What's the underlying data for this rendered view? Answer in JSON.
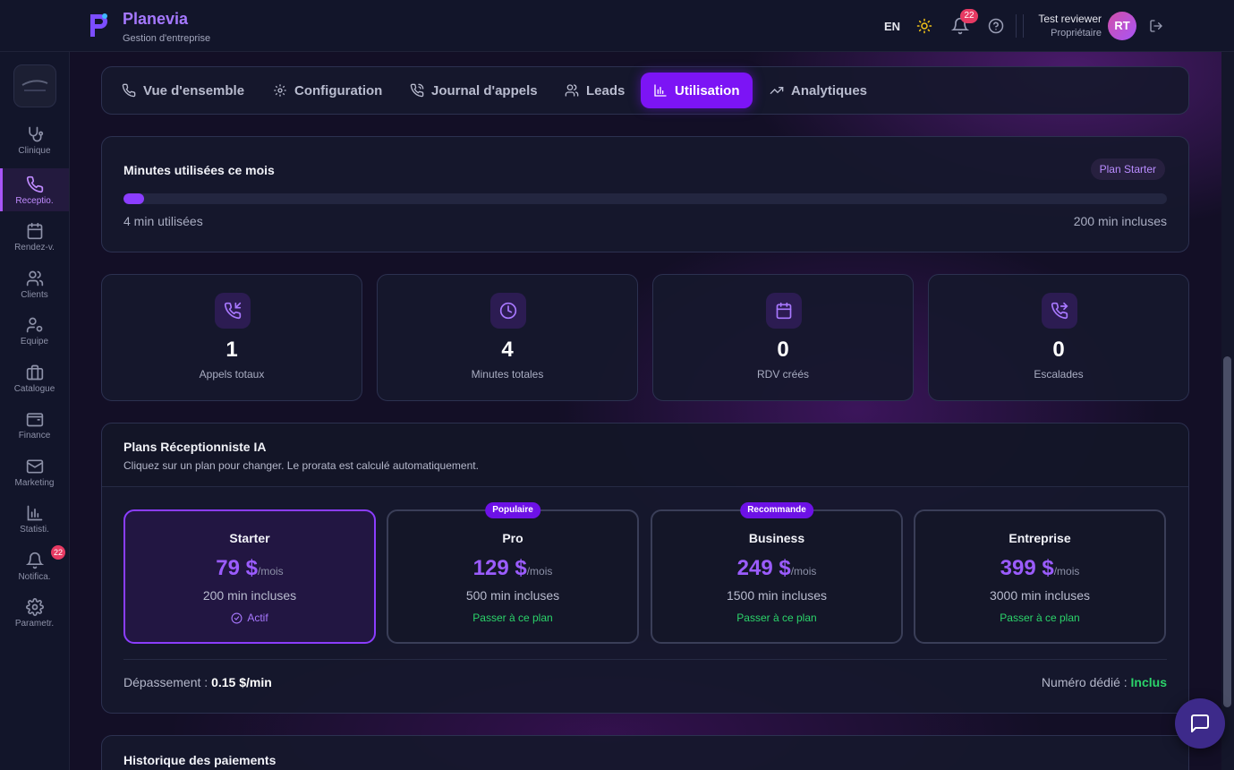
{
  "brand": {
    "name": "Planevia",
    "subtitle": "Gestion d'entreprise"
  },
  "header": {
    "language": "EN",
    "notifications_count": "22",
    "user": {
      "name": "Test reviewer",
      "role": "Propriétaire",
      "initials": "RT"
    }
  },
  "sidebar": {
    "items": [
      {
        "label": "Clinique",
        "icon": "stethoscope-icon"
      },
      {
        "label": "Receptio.",
        "icon": "phone-icon",
        "active": true
      },
      {
        "label": "Rendez-v.",
        "icon": "calendar-icon"
      },
      {
        "label": "Clients",
        "icon": "users-icon"
      },
      {
        "label": "Equipe",
        "icon": "user-gear-icon"
      },
      {
        "label": "Catalogue",
        "icon": "briefcase-icon"
      },
      {
        "label": "Finance",
        "icon": "wallet-icon"
      },
      {
        "label": "Marketing",
        "icon": "mail-icon"
      },
      {
        "label": "Statisti.",
        "icon": "bar-chart-icon"
      },
      {
        "label": "Notifica.",
        "icon": "bell-icon",
        "badge": "22"
      },
      {
        "label": "Parametr.",
        "icon": "gear-icon"
      }
    ]
  },
  "tabs": [
    {
      "label": "Vue d'ensemble",
      "icon": "phone-icon"
    },
    {
      "label": "Configuration",
      "icon": "gear-icon"
    },
    {
      "label": "Journal d'appels",
      "icon": "phone-call-icon"
    },
    {
      "label": "Leads",
      "icon": "users-icon"
    },
    {
      "label": "Utilisation",
      "icon": "bar-chart-icon",
      "active": true
    },
    {
      "label": "Analytiques",
      "icon": "trending-up-icon"
    }
  ],
  "usage": {
    "title": "Minutes utilisées ce mois",
    "plan_badge": "Plan Starter",
    "used_label": "4 min utilisées",
    "included_label": "200 min incluses",
    "used": 4,
    "included": 200
  },
  "stats": [
    {
      "value": "1",
      "label": "Appels totaux",
      "icon": "phone-incoming-icon"
    },
    {
      "value": "4",
      "label": "Minutes totales",
      "icon": "clock-icon"
    },
    {
      "value": "0",
      "label": "RDV créés",
      "icon": "calendar-icon"
    },
    {
      "value": "0",
      "label": "Escalades",
      "icon": "phone-forward-icon"
    }
  ],
  "plans": {
    "title": "Plans Réceptionniste IA",
    "subtitle": "Cliquez sur un plan pour changer. Le prorata est calculé automatiquement.",
    "items": [
      {
        "name": "Starter",
        "price": "79 $",
        "period": "/mois",
        "minutes": "200 min incluses",
        "action": "Actif",
        "current": true
      },
      {
        "name": "Pro",
        "price": "129 $",
        "period": "/mois",
        "minutes": "500 min incluses",
        "action": "Passer à ce plan",
        "badge": "Populaire"
      },
      {
        "name": "Business",
        "price": "249 $",
        "period": "/mois",
        "minutes": "1500 min incluses",
        "action": "Passer à ce plan",
        "badge": "Recommande"
      },
      {
        "name": "Entreprise",
        "price": "399 $",
        "period": "/mois",
        "minutes": "3000 min incluses",
        "action": "Passer à ce plan"
      }
    ],
    "overage_label": "Dépassement :",
    "overage_value": "0.15 $/min",
    "dedicated_label": "Numéro dédié :",
    "dedicated_value": "Inclus"
  },
  "history": {
    "title": "Historique des paiements"
  },
  "colors": {
    "accent": "#7c14f5",
    "accent_text": "#9b5cff",
    "success": "#2bd46a",
    "badge": "#e73a63"
  }
}
